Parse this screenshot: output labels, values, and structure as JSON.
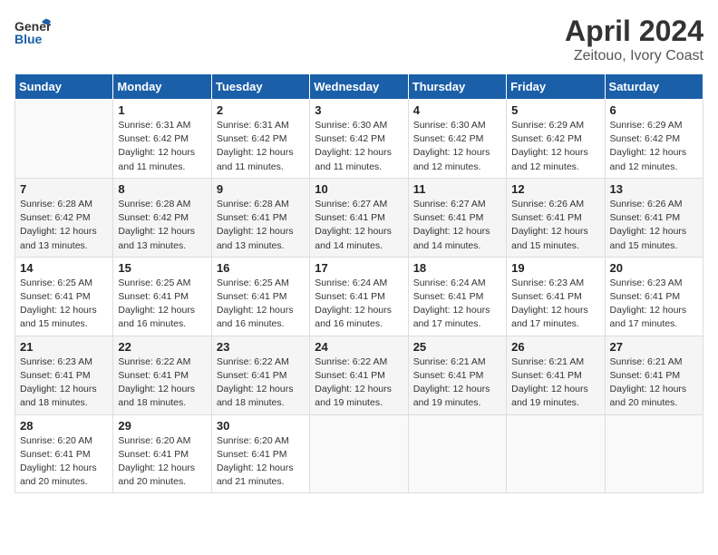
{
  "header": {
    "logo_general": "General",
    "logo_blue": "Blue",
    "month": "April 2024",
    "location": "Zeitouo, Ivory Coast"
  },
  "weekdays": [
    "Sunday",
    "Monday",
    "Tuesday",
    "Wednesday",
    "Thursday",
    "Friday",
    "Saturday"
  ],
  "weeks": [
    [
      {
        "day": "",
        "empty": true
      },
      {
        "day": "1",
        "sunrise": "6:31 AM",
        "sunset": "6:42 PM",
        "daylight": "12 hours and 11 minutes."
      },
      {
        "day": "2",
        "sunrise": "6:31 AM",
        "sunset": "6:42 PM",
        "daylight": "12 hours and 11 minutes."
      },
      {
        "day": "3",
        "sunrise": "6:30 AM",
        "sunset": "6:42 PM",
        "daylight": "12 hours and 11 minutes."
      },
      {
        "day": "4",
        "sunrise": "6:30 AM",
        "sunset": "6:42 PM",
        "daylight": "12 hours and 12 minutes."
      },
      {
        "day": "5",
        "sunrise": "6:29 AM",
        "sunset": "6:42 PM",
        "daylight": "12 hours and 12 minutes."
      },
      {
        "day": "6",
        "sunrise": "6:29 AM",
        "sunset": "6:42 PM",
        "daylight": "12 hours and 12 minutes."
      }
    ],
    [
      {
        "day": "7",
        "sunrise": "6:28 AM",
        "sunset": "6:42 PM",
        "daylight": "12 hours and 13 minutes."
      },
      {
        "day": "8",
        "sunrise": "6:28 AM",
        "sunset": "6:42 PM",
        "daylight": "12 hours and 13 minutes."
      },
      {
        "day": "9",
        "sunrise": "6:28 AM",
        "sunset": "6:41 PM",
        "daylight": "12 hours and 13 minutes."
      },
      {
        "day": "10",
        "sunrise": "6:27 AM",
        "sunset": "6:41 PM",
        "daylight": "12 hours and 14 minutes."
      },
      {
        "day": "11",
        "sunrise": "6:27 AM",
        "sunset": "6:41 PM",
        "daylight": "12 hours and 14 minutes."
      },
      {
        "day": "12",
        "sunrise": "6:26 AM",
        "sunset": "6:41 PM",
        "daylight": "12 hours and 15 minutes."
      },
      {
        "day": "13",
        "sunrise": "6:26 AM",
        "sunset": "6:41 PM",
        "daylight": "12 hours and 15 minutes."
      }
    ],
    [
      {
        "day": "14",
        "sunrise": "6:25 AM",
        "sunset": "6:41 PM",
        "daylight": "12 hours and 15 minutes."
      },
      {
        "day": "15",
        "sunrise": "6:25 AM",
        "sunset": "6:41 PM",
        "daylight": "12 hours and 16 minutes."
      },
      {
        "day": "16",
        "sunrise": "6:25 AM",
        "sunset": "6:41 PM",
        "daylight": "12 hours and 16 minutes."
      },
      {
        "day": "17",
        "sunrise": "6:24 AM",
        "sunset": "6:41 PM",
        "daylight": "12 hours and 16 minutes."
      },
      {
        "day": "18",
        "sunrise": "6:24 AM",
        "sunset": "6:41 PM",
        "daylight": "12 hours and 17 minutes."
      },
      {
        "day": "19",
        "sunrise": "6:23 AM",
        "sunset": "6:41 PM",
        "daylight": "12 hours and 17 minutes."
      },
      {
        "day": "20",
        "sunrise": "6:23 AM",
        "sunset": "6:41 PM",
        "daylight": "12 hours and 17 minutes."
      }
    ],
    [
      {
        "day": "21",
        "sunrise": "6:23 AM",
        "sunset": "6:41 PM",
        "daylight": "12 hours and 18 minutes."
      },
      {
        "day": "22",
        "sunrise": "6:22 AM",
        "sunset": "6:41 PM",
        "daylight": "12 hours and 18 minutes."
      },
      {
        "day": "23",
        "sunrise": "6:22 AM",
        "sunset": "6:41 PM",
        "daylight": "12 hours and 18 minutes."
      },
      {
        "day": "24",
        "sunrise": "6:22 AM",
        "sunset": "6:41 PM",
        "daylight": "12 hours and 19 minutes."
      },
      {
        "day": "25",
        "sunrise": "6:21 AM",
        "sunset": "6:41 PM",
        "daylight": "12 hours and 19 minutes."
      },
      {
        "day": "26",
        "sunrise": "6:21 AM",
        "sunset": "6:41 PM",
        "daylight": "12 hours and 19 minutes."
      },
      {
        "day": "27",
        "sunrise": "6:21 AM",
        "sunset": "6:41 PM",
        "daylight": "12 hours and 20 minutes."
      }
    ],
    [
      {
        "day": "28",
        "sunrise": "6:20 AM",
        "sunset": "6:41 PM",
        "daylight": "12 hours and 20 minutes."
      },
      {
        "day": "29",
        "sunrise": "6:20 AM",
        "sunset": "6:41 PM",
        "daylight": "12 hours and 20 minutes."
      },
      {
        "day": "30",
        "sunrise": "6:20 AM",
        "sunset": "6:41 PM",
        "daylight": "12 hours and 21 minutes."
      },
      {
        "day": "",
        "empty": true
      },
      {
        "day": "",
        "empty": true
      },
      {
        "day": "",
        "empty": true
      },
      {
        "day": "",
        "empty": true
      }
    ]
  ],
  "labels": {
    "sunrise": "Sunrise:",
    "sunset": "Sunset:",
    "daylight": "Daylight:"
  }
}
